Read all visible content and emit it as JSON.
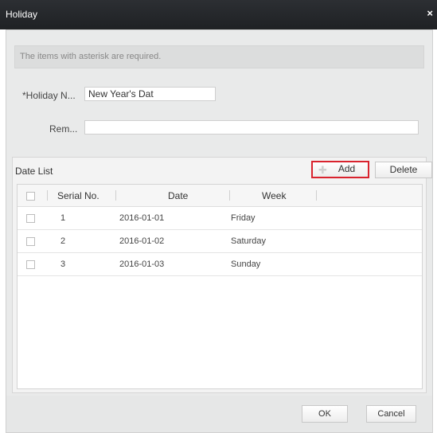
{
  "window": {
    "title": "Holiday",
    "close_glyph": "×"
  },
  "note": "The items with asterisk are required.",
  "form": {
    "holiday_name_label": "*Holiday N...",
    "holiday_name_value": "New Year's Dat",
    "remark_label": "Rem...",
    "remark_value": ""
  },
  "date_list": {
    "title": "Date List",
    "add_label": "Add",
    "add_icon": "plus-icon",
    "delete_label": "Delete",
    "columns": [
      "Serial No.",
      "Date",
      "Week"
    ],
    "rows": [
      {
        "serial": "1",
        "date": "2016-01-01",
        "week": "Friday"
      },
      {
        "serial": "2",
        "date": "2016-01-02",
        "week": "Saturday"
      },
      {
        "serial": "3",
        "date": "2016-01-03",
        "week": "Sunday"
      }
    ]
  },
  "footer": {
    "ok_label": "OK",
    "cancel_label": "Cancel"
  },
  "colors": {
    "titlebar": "#1f2124",
    "highlight": "#d9232e"
  }
}
